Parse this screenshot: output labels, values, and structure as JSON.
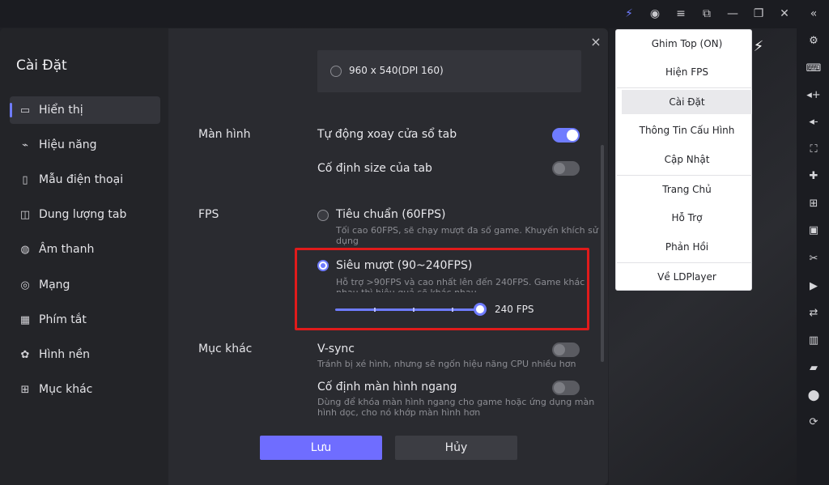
{
  "dialog": {
    "title": "Cài Đặt",
    "close_icon": "×"
  },
  "sidebar": {
    "items": [
      {
        "label": "Hiển thị",
        "icon": "▭"
      },
      {
        "label": "Hiệu năng",
        "icon": "⌁"
      },
      {
        "label": "Mẫu điện thoại",
        "icon": "▯"
      },
      {
        "label": "Dung lượng tab",
        "icon": "◫"
      },
      {
        "label": "Âm thanh",
        "icon": "◍"
      },
      {
        "label": "Mạng",
        "icon": "◎"
      },
      {
        "label": "Phím tắt",
        "icon": "▦"
      },
      {
        "label": "Hình nền",
        "icon": "✿"
      },
      {
        "label": "Mục khác",
        "icon": "⊞"
      }
    ]
  },
  "content": {
    "resolution_option": "960 x 540(DPI 160)",
    "screen_section": "Màn hình",
    "auto_rotate_label": "Tự động xoay cửa sổ tab",
    "fixed_size_label": "Cố định size của tab",
    "fps_section": "FPS",
    "fps_standard_label": "Tiêu chuẩn (60FPS)",
    "fps_standard_desc_1": "Tối cao 60FPS, sẽ chạy mượt đa số game. Khuyến khích sử",
    "fps_standard_desc_2": "dụng",
    "fps_ultra_label": "Siêu mượt (90~240FPS)",
    "fps_ultra_desc_1": "Hỗ trợ >90FPS và cao nhất lên đến 240FPS. Game khác",
    "fps_ultra_desc_2": "nhau thì hiệu quả sẽ khác nhau",
    "fps_value_label": "240 FPS",
    "fps_slider_fraction": 1.0,
    "other_section": "Mục khác",
    "vsync_label": "V-sync",
    "vsync_desc": "Tránh bị xé hình, nhưng sẽ ngốn hiệu năng CPU nhiều hơn",
    "landscape_label": "Cố định màn hình ngang",
    "landscape_desc_1": "Dùng để khóa màn hình ngang cho game hoặc ứng dụng màn",
    "landscape_desc_2": "hình dọc, cho nó khớp màn hình hơn",
    "toggles": {
      "auto_rotate": true,
      "fixed_size": false,
      "vsync": false,
      "landscape": false
    },
    "save_label": "Lưu",
    "cancel_label": "Hủy"
  },
  "menu": {
    "items": [
      "Ghim Top (ON)",
      "Hiện FPS",
      "Cài Đặt",
      "Thông Tin Cấu Hình",
      "Cập Nhật",
      "Trang Chủ",
      "Hỗ Trợ",
      "Phản Hồi",
      "Về LDPlayer"
    ],
    "active": "Cài Đặt"
  },
  "colors": {
    "accent": "#6f7cff",
    "highlight_border": "#e01b1b"
  }
}
